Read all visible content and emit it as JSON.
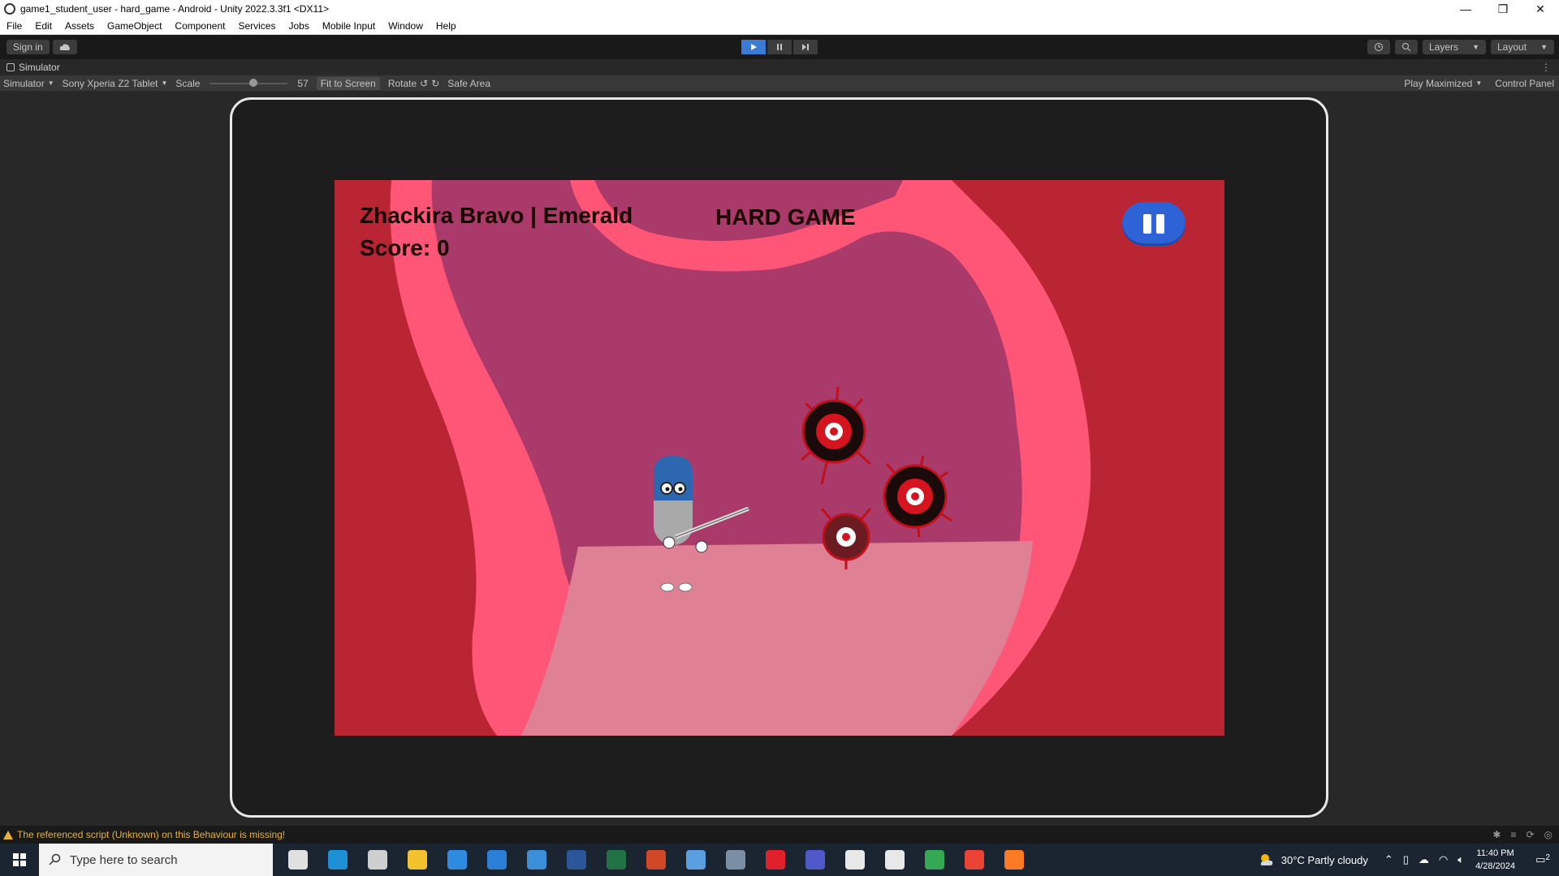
{
  "window": {
    "title": "game1_student_user - hard_game - Android - Unity 2022.3.3f1 <DX11>",
    "minimize": "—",
    "restore": "❐",
    "close": "✕"
  },
  "menu": [
    "File",
    "Edit",
    "Assets",
    "GameObject",
    "Component",
    "Services",
    "Jobs",
    "Mobile Input",
    "Window",
    "Help"
  ],
  "toolbar": {
    "sign_in": "Sign in",
    "layers": "Layers",
    "layout": "Layout"
  },
  "simulator_tab": {
    "label": "Simulator"
  },
  "simulator_options": {
    "mode": "Simulator",
    "device": "Sony Xperia Z2 Tablet",
    "scale_label": "Scale",
    "scale_value": "57",
    "scale_fraction": 0.57,
    "fit_to_screen": "Fit to Screen",
    "rotate": "Rotate",
    "safe_area": "Safe Area",
    "play_mode": "Play Maximized",
    "control_panel": "Control Panel"
  },
  "game": {
    "player_name": "Zhackira Bravo |   Emerald",
    "score_label": "Score:",
    "score_value": "0",
    "title": "HARD GAME"
  },
  "status": {
    "warning": "The referenced script (Unknown) on this Behaviour is missing!"
  },
  "taskbar": {
    "search_placeholder": "Type here to search",
    "weather": "30°C  Partly cloudy",
    "time": "11:40 PM",
    "date": "4/28/2024",
    "notification_count": "2",
    "apps": [
      {
        "name": "task-view",
        "color": "#e0e0e0"
      },
      {
        "name": "edge",
        "color": "#1e90d6"
      },
      {
        "name": "settings",
        "color": "#cfcfcf"
      },
      {
        "name": "file-explorer",
        "color": "#f2c12e"
      },
      {
        "name": "store",
        "color": "#2d8be0"
      },
      {
        "name": "mail",
        "color": "#2b7fd6"
      },
      {
        "name": "remote-desktop",
        "color": "#3a8fd8"
      },
      {
        "name": "word",
        "color": "#2b579a"
      },
      {
        "name": "excel",
        "color": "#217346"
      },
      {
        "name": "powerpoint",
        "color": "#d24726"
      },
      {
        "name": "cloud-app",
        "color": "#5aa0e0"
      },
      {
        "name": "calculator",
        "color": "#7a8fa6"
      },
      {
        "name": "opera",
        "color": "#e0202b"
      },
      {
        "name": "teams",
        "color": "#5059c9"
      },
      {
        "name": "unity-hub",
        "color": "#e8e8e8"
      },
      {
        "name": "unity-editor",
        "color": "#e8e8e8"
      },
      {
        "name": "chrome",
        "color": "#34a853"
      },
      {
        "name": "chrome-profile",
        "color": "#ea4335"
      },
      {
        "name": "xampp",
        "color": "#fb7a24"
      }
    ]
  }
}
